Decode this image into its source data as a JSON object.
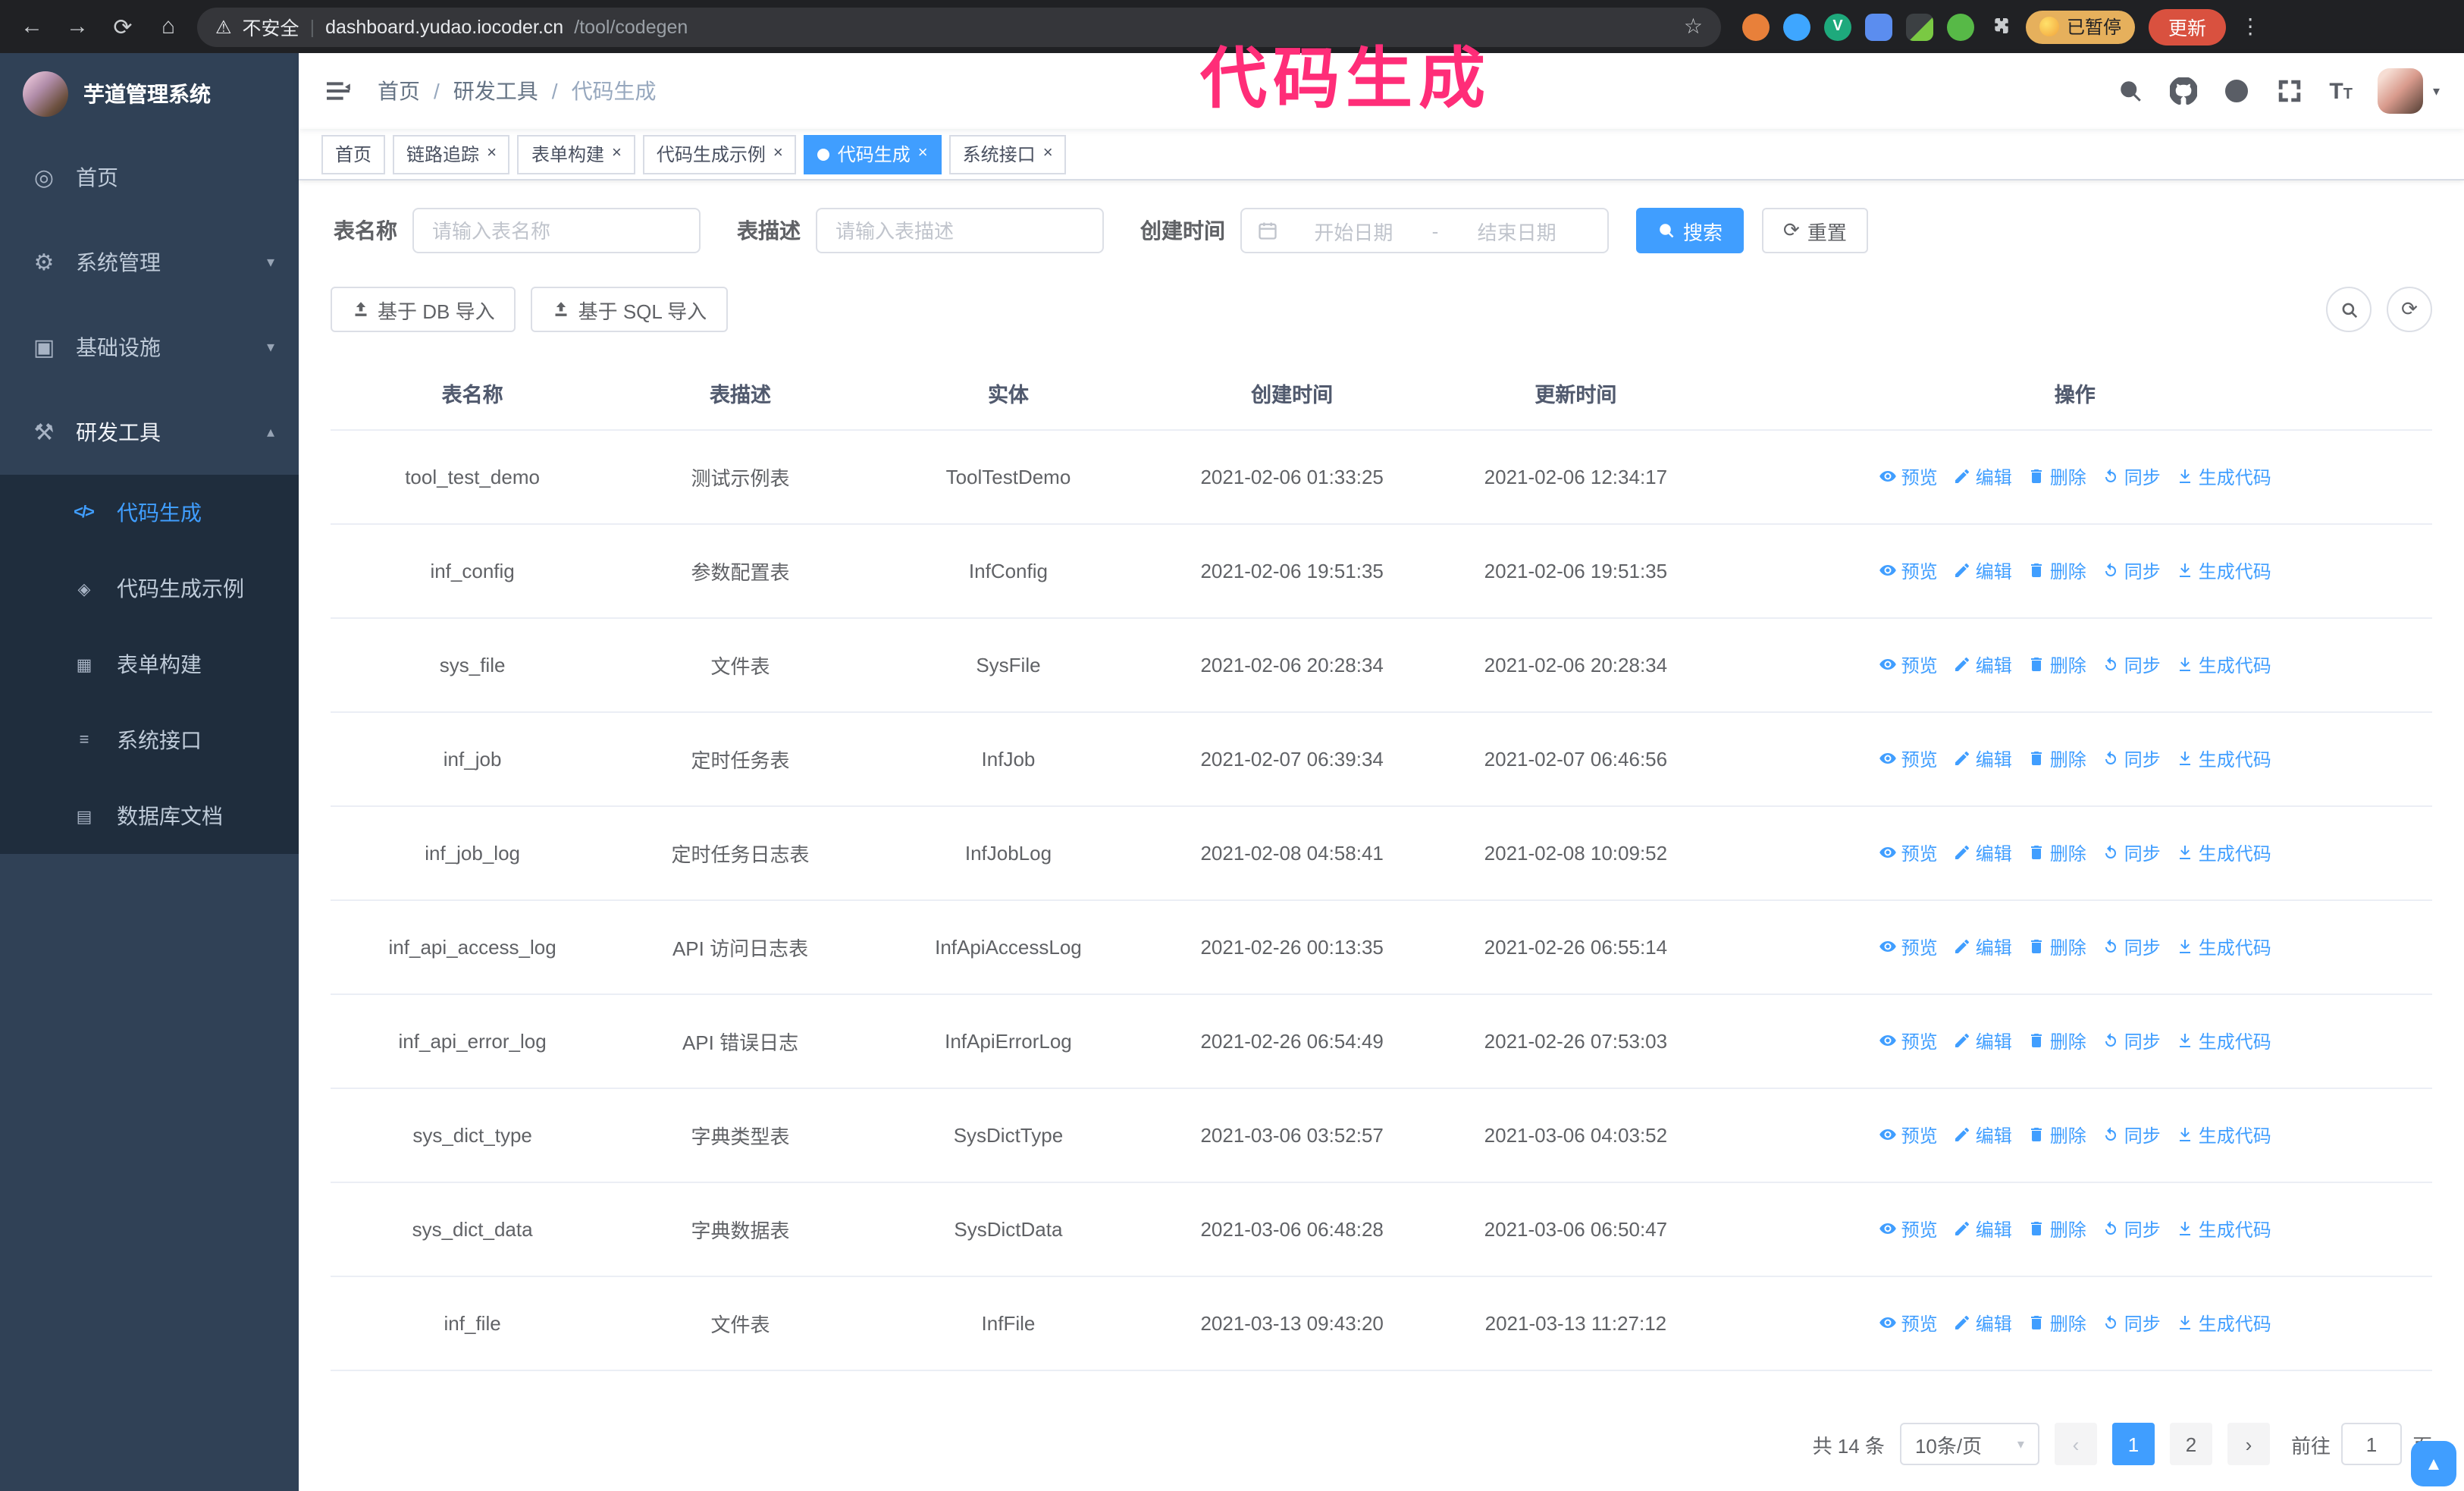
{
  "annotation": {
    "text": "代码生成",
    "color": "#ff2d78"
  },
  "browser": {
    "security_label": "不安全",
    "url_host": "dashboard.yudao.iocoder.cn",
    "url_path": "/tool/codegen",
    "paused_badge": "已暂停",
    "update_button": "更新"
  },
  "icons": {
    "back": "←",
    "forward": "→",
    "reload": "⟳",
    "home": "⌂",
    "warning": "⚠",
    "star": "☆",
    "kebab": "⋮",
    "menu_dashboard": "◎",
    "menu_gear": "⚙",
    "menu_infra": "▣",
    "menu_tools": "⚒",
    "chevron_down": "▾",
    "chevron_up": "▴",
    "caret_down": "▾",
    "sub_code": "</>",
    "sub_example": "◈",
    "sub_form": "▦",
    "sub_api": "≡",
    "sub_db": "▤",
    "close": "×",
    "prev": "‹",
    "next": "›",
    "font_size_big": "T",
    "font_size_small": "T",
    "back_top": "▲"
  },
  "sidebar": {
    "app_title": "芋道管理系统",
    "items": [
      {
        "label": "首页"
      },
      {
        "label": "系统管理"
      },
      {
        "label": "基础设施"
      },
      {
        "label": "研发工具"
      }
    ],
    "submenu": [
      {
        "label": "代码生成"
      },
      {
        "label": "代码生成示例"
      },
      {
        "label": "表单构建"
      },
      {
        "label": "系统接口"
      },
      {
        "label": "数据库文档"
      }
    ]
  },
  "header": {
    "breadcrumb": [
      "首页",
      "研发工具",
      "代码生成"
    ],
    "separator": "/"
  },
  "tabs": [
    {
      "label": "首页"
    },
    {
      "label": "链路追踪"
    },
    {
      "label": "表单构建"
    },
    {
      "label": "代码生成示例"
    },
    {
      "label": "代码生成"
    },
    {
      "label": "系统接口"
    }
  ],
  "filters": {
    "table_name_label": "表名称",
    "table_name_placeholder": "请输入表名称",
    "table_desc_label": "表描述",
    "table_desc_placeholder": "请输入表描述",
    "create_time_label": "创建时间",
    "date_start_placeholder": "开始日期",
    "date_separator": "-",
    "date_end_placeholder": "结束日期",
    "search_button": "搜索",
    "reset_button": "重置"
  },
  "toolbar": {
    "import_db_button": "基于 DB 导入",
    "import_sql_button": "基于 SQL 导入"
  },
  "table": {
    "columns": [
      "表名称",
      "表描述",
      "实体",
      "创建时间",
      "更新时间",
      "操作"
    ],
    "actions": [
      "预览",
      "编辑",
      "删除",
      "同步",
      "生成代码"
    ],
    "rows": [
      {
        "name": "tool_test_demo",
        "desc": "测试示例表",
        "entity": "ToolTestDemo",
        "created": "2021-02-06 01:33:25",
        "updated": "2021-02-06 12:34:17"
      },
      {
        "name": "inf_config",
        "desc": "参数配置表",
        "entity": "InfConfig",
        "created": "2021-02-06 19:51:35",
        "updated": "2021-02-06 19:51:35"
      },
      {
        "name": "sys_file",
        "desc": "文件表",
        "entity": "SysFile",
        "created": "2021-02-06 20:28:34",
        "updated": "2021-02-06 20:28:34"
      },
      {
        "name": "inf_job",
        "desc": "定时任务表",
        "entity": "InfJob",
        "created": "2021-02-07 06:39:34",
        "updated": "2021-02-07 06:46:56"
      },
      {
        "name": "inf_job_log",
        "desc": "定时任务日志表",
        "entity": "InfJobLog",
        "created": "2021-02-08 04:58:41",
        "updated": "2021-02-08 10:09:52"
      },
      {
        "name": "inf_api_access_log",
        "desc": "API 访问日志表",
        "entity": "InfApiAccessLog",
        "created": "2021-02-26 00:13:35",
        "updated": "2021-02-26 06:55:14"
      },
      {
        "name": "inf_api_error_log",
        "desc": "API 错误日志",
        "entity": "InfApiErrorLog",
        "created": "2021-02-26 06:54:49",
        "updated": "2021-02-26 07:53:03"
      },
      {
        "name": "sys_dict_type",
        "desc": "字典类型表",
        "entity": "SysDictType",
        "created": "2021-03-06 03:52:57",
        "updated": "2021-03-06 04:03:52"
      },
      {
        "name": "sys_dict_data",
        "desc": "字典数据表",
        "entity": "SysDictData",
        "created": "2021-03-06 06:48:28",
        "updated": "2021-03-06 06:50:47"
      },
      {
        "name": "inf_file",
        "desc": "文件表",
        "entity": "InfFile",
        "created": "2021-03-13 09:43:20",
        "updated": "2021-03-13 11:27:12"
      }
    ]
  },
  "pagination": {
    "total_text": "共 14 条",
    "page_size": "10条/页",
    "pages": [
      "1",
      "2"
    ],
    "active_page": "1",
    "goto_prefix": "前往",
    "goto_value": "1",
    "goto_suffix": "页"
  },
  "colors": {
    "primary": "#409eff",
    "sidebar_bg": "#304156",
    "submenu_bg": "#1f2d3d",
    "chrome_bg": "#202124",
    "annotation": "#ff2d78",
    "update_button_bg": "#d9513f",
    "paused_badge_bg": "#e6b05c"
  }
}
